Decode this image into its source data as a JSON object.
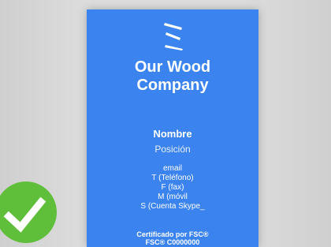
{
  "card": {
    "company_line1": "Our Wood",
    "company_line2": "Company",
    "name": "Nombre",
    "position": "Posición",
    "contacts": [
      "email",
      "T (Teléfono)",
      "F (fax)",
      "M (móvil",
      "S (Cuenta Skype_"
    ],
    "certification_line1": "Certificado por FSC®",
    "certification_line2": "FSC® C0000000",
    "background_color": "#3b83ee",
    "logo_icon": "stripes-logo-icon"
  },
  "badge": {
    "icon": "checkmark-icon",
    "color": "#5fbe3a"
  }
}
